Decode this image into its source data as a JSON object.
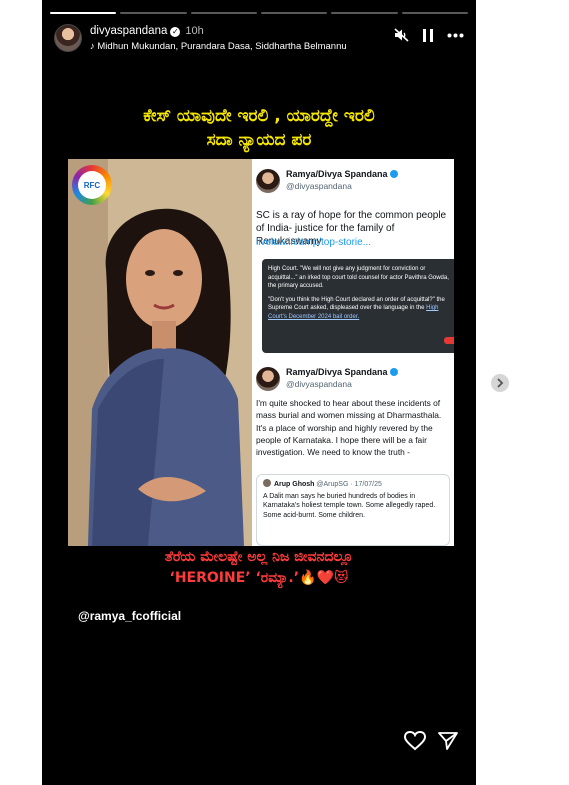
{
  "story": {
    "username": "divyaspandana",
    "time": "10h",
    "music": "Midhun Mukundan, Purandara Dasa, Siddhartha Belmannu",
    "progress_segments": 6,
    "active_segment": 1
  },
  "overlay": {
    "top_line1": "ಕೇಸ್ ಯಾವುದೇ ಇರಲಿ , ಯಾರದ್ದೇ ಇರಲಿ",
    "top_line2": "ಸದಾ ನ್ಯಾಯದ ಪರ",
    "bottom_line1": "ತೆರೆಯ ಮೇಲಷ್ಟೇ ಅಲ್ಲ ನಿಜ ಜೀವನದಲ್ಲೂ",
    "bottom_line2": "‘HEROINE’ ‘ರಮ್ಯಾ.’🔥❤️😻",
    "handle": "@ramya_fcofficial"
  },
  "collage": {
    "logo_text": "RFC",
    "tweet1": {
      "name": "Ramya/Divya Spandana",
      "handle": "@divyaspandana",
      "text": "SC is a ray of hope for the common people of India- justice for the family of Renukaswamy",
      "link": "livelaw.in/amp/top-storie...",
      "quote_p1": "High Court. \"We will not give any judgment for conviction or acquittal...\" an irked top court told counsel for actor Pavithra Gowda, the primary accused.",
      "quote_p2": "\"Don't you think the High Court declared an order of acquittal?\" the Supreme Court asked, displeased over the language in the",
      "quote_link": "High Court's December 2024 bail order."
    },
    "tweet2": {
      "name": "Ramya/Divya Spandana",
      "handle": "@divyaspandana",
      "text": "I'm quite shocked to hear about these incidents of mass burial and women missing at Dharmasthala. It's a place of worship and highly revered by the people of Karnataka. I hope there will be a fair investigation. We need to know the truth -",
      "quoted_name": "Arup Ghosh",
      "quoted_handle": "@ArupSG · 17/07/25",
      "quoted_text": "A Dalit man says he buried hundreds of bodies in Karnataka's holiest temple town. Some allegedly raped. Some acid-burnt. Some children."
    }
  },
  "colors": {
    "background": "#000000",
    "top_caption": "#f5e600",
    "bottom_caption": "#ff3b3b",
    "link": "#1d9bf0"
  }
}
